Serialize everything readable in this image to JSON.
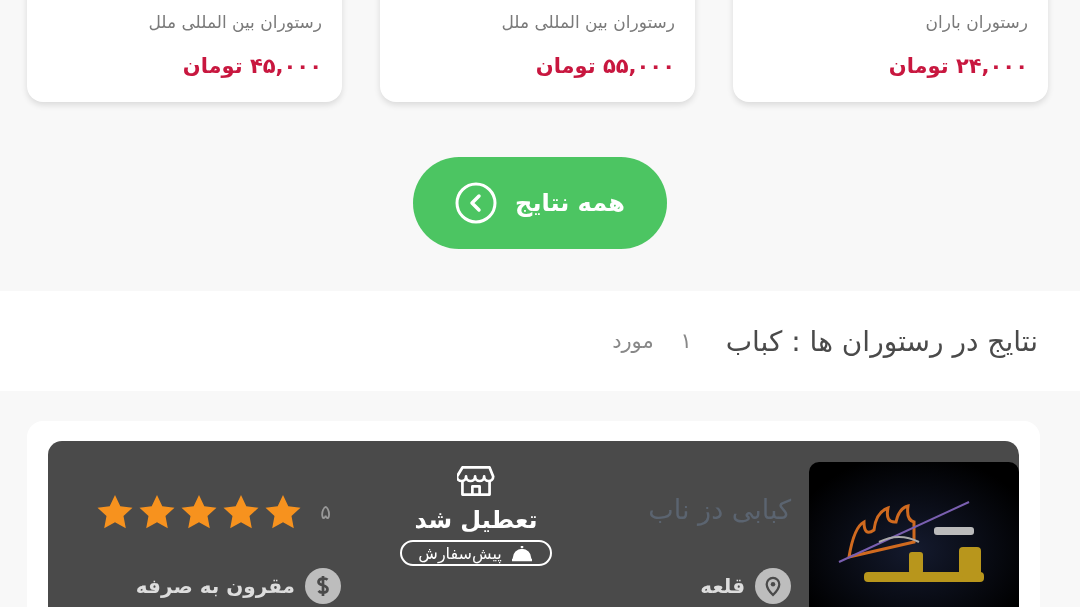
{
  "food_cards": [
    {
      "restaurant": "رستوران باران",
      "price": "۲۴,۰۰۰ تومان"
    },
    {
      "restaurant": "رستوران بین المللی ملل",
      "price": "۵۵,۰۰۰ تومان"
    },
    {
      "restaurant": "رستوران بین المللی ملل",
      "price": "۴۵,۰۰۰ تومان"
    }
  ],
  "all_results_button": {
    "label": "همه نتایج"
  },
  "results_header": {
    "title": "نتایج در رستوران ها :",
    "query": "کباب",
    "count": "۱",
    "count_unit": "مورد"
  },
  "restaurants": [
    {
      "name": "کبابی دز ناب",
      "closed": true,
      "status": "تعطیل شد",
      "preorder_label": "پیش‌سفارش",
      "rating": "۵",
      "stars": 5,
      "location": "قلعه",
      "price_tag": "مقرون به صرفه"
    }
  ]
}
